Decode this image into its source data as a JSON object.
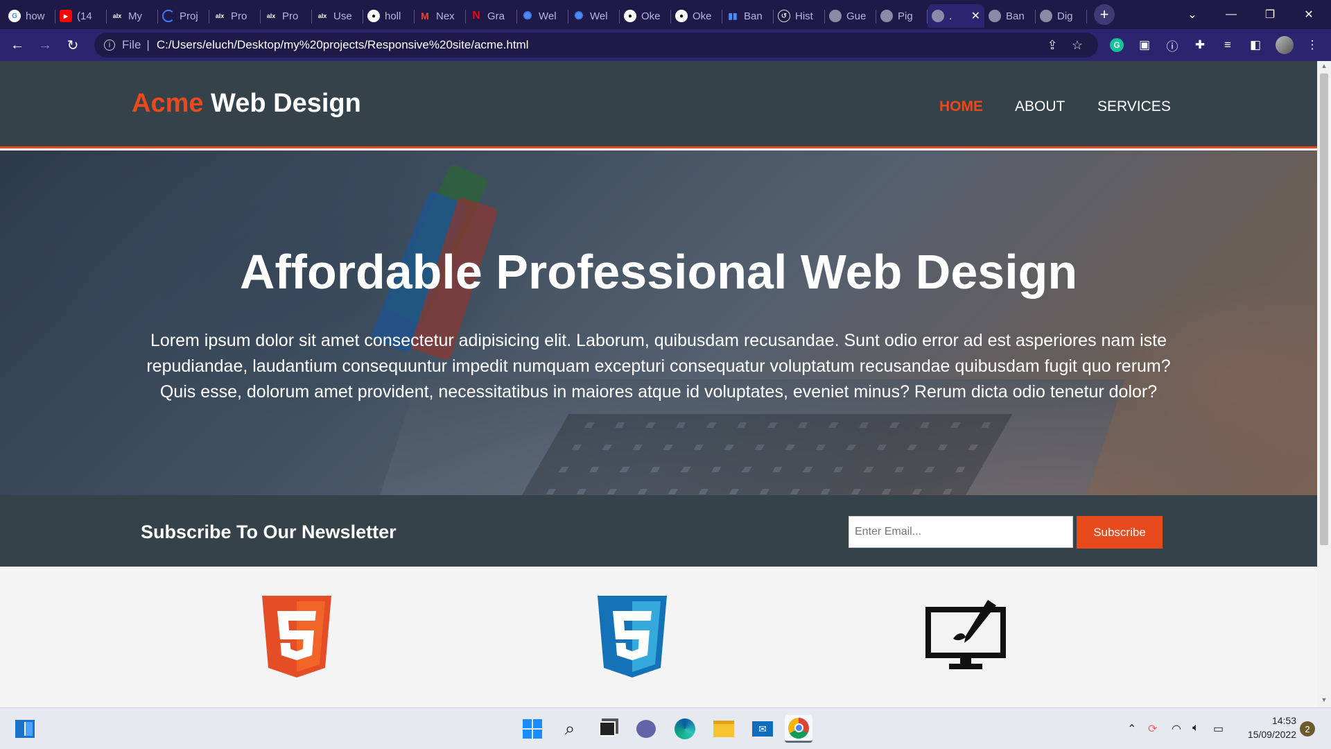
{
  "browser": {
    "tabs": [
      {
        "label": "how",
        "icon": "google-icon"
      },
      {
        "label": "(14",
        "icon": "youtube-icon"
      },
      {
        "label": "My",
        "icon": "alx-icon"
      },
      {
        "label": "Proj",
        "icon": "progress-icon"
      },
      {
        "label": "Pro",
        "icon": "alx-icon"
      },
      {
        "label": "Pro",
        "icon": "alx-icon"
      },
      {
        "label": "Use",
        "icon": "alx-icon"
      },
      {
        "label": "holl",
        "icon": "github-icon"
      },
      {
        "label": "Nex",
        "icon": "gmail-icon"
      },
      {
        "label": "Gra",
        "icon": "n-icon"
      },
      {
        "label": "Wel",
        "icon": "gear-icon"
      },
      {
        "label": "Wel",
        "icon": "gear-icon"
      },
      {
        "label": "Oke",
        "icon": "github-icon"
      },
      {
        "label": "Oke",
        "icon": "github-icon"
      },
      {
        "label": "Ban",
        "icon": "bar-icon"
      },
      {
        "label": "Hist",
        "icon": "history-icon"
      },
      {
        "label": "Gue",
        "icon": "globe-icon"
      },
      {
        "label": "Pig",
        "icon": "globe-icon"
      },
      {
        "label": ".",
        "icon": "globe-icon",
        "active": true
      },
      {
        "label": "Ban",
        "icon": "globe-icon"
      },
      {
        "label": "Dig",
        "icon": "globe-icon"
      }
    ],
    "address": {
      "scheme": "File",
      "path": "C:/Users/eluch/Desktop/my%20projects/Responsive%20site/acme.html"
    }
  },
  "page": {
    "logo": {
      "highlight": "Acme",
      "rest": " Web Design"
    },
    "nav": [
      {
        "label": "HOME",
        "current": true
      },
      {
        "label": "ABOUT",
        "current": false
      },
      {
        "label": "SERVICES",
        "current": false
      }
    ],
    "showcase": {
      "title": "Affordable Professional Web Design",
      "text": "Lorem ipsum dolor sit amet consectetur adipisicing elit. Laborum, quibusdam recusandae. Sunt odio error ad est asperiores nam iste repudiandae, laudantium consequuntur impedit numquam excepturi consequatur voluptatum recusandae quibusdam fugit quo rerum? Quis esse, dolorum amet provident, necessitatibus in maiores atque id voluptates, eveniet minus? Rerum dicta odio tenetur dolor?"
    },
    "newsletter": {
      "heading": "Subscribe To Our Newsletter",
      "email_placeholder": "Enter Email...",
      "button": "Subscribe"
    },
    "boxes": [
      {
        "icon": "html5-icon"
      },
      {
        "icon": "css3-icon"
      },
      {
        "icon": "design-monitor-icon"
      }
    ]
  },
  "taskbar": {
    "time": "14:53",
    "date": "15/09/2022",
    "notifications": "2"
  },
  "colors": {
    "brand_accent": "#e8491d",
    "header_bg": "#35424a",
    "tabbar_bg": "#1f1948"
  }
}
